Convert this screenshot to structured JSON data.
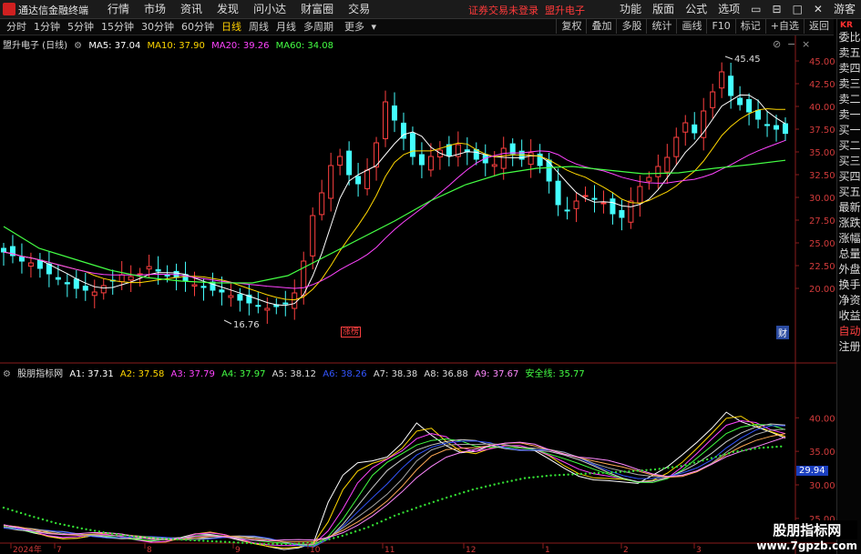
{
  "app": {
    "title": "通达信金融终端",
    "warning": "证券交易未登录",
    "stock_tab": "盟升电子",
    "guest": "游客"
  },
  "menu": [
    "行情",
    "市场",
    "资讯",
    "发现",
    "问小达",
    "财富圈",
    "交易"
  ],
  "right_menu": [
    "功能",
    "版面",
    "公式",
    "选项"
  ],
  "periods": [
    "分时",
    "1分钟",
    "5分钟",
    "15分钟",
    "30分钟",
    "60分钟",
    "日线",
    "周线",
    "月线",
    "多周期",
    "更多"
  ],
  "active_period": "日线",
  "right_tools": [
    "复权",
    "叠加",
    "多股",
    "统计",
    "画线",
    "F10",
    "标记",
    "+自选",
    "返回"
  ],
  "side_panel": {
    "kr": "KR",
    "items": [
      "委比",
      "卖五",
      "卖四",
      "卖三",
      "卖二",
      "卖一",
      "买一",
      "买二",
      "买三",
      "买四",
      "买五",
      "最新",
      "涨跌",
      "涨幅",
      "总量",
      "外盘",
      "换手",
      "净资",
      "收益"
    ],
    "items2": [
      "自动",
      "注册"
    ]
  },
  "main_legend": {
    "stock": "盟升电子 (日线)",
    "ma5": "MA5: 37.04",
    "ma10": "MA10: 37.90",
    "ma20": "MA20: 39.26",
    "ma60": "MA60: 34.08"
  },
  "sub_legend": {
    "name": "股朋指标网",
    "a1": "A1: 37.31",
    "a2": "A2: 37.58",
    "a3": "A3: 37.79",
    "a4": "A4: 37.97",
    "a5": "A5: 38.12",
    "a6": "A6: 38.26",
    "a7": "A7: 38.38",
    "a8": "A8: 36.88",
    "a9": "A9: 37.67",
    "safe": "安全线: 35.77"
  },
  "colors": {
    "ma5": "#ffffff",
    "ma10": "#ffd700",
    "ma20": "#ff44ff",
    "ma60": "#44ff44",
    "up": "#ff4040",
    "down": "#44ffff"
  },
  "annotations": {
    "high": "45.45",
    "low": "16.76",
    "tag": "涨榜",
    "cai": "财",
    "cursor_value": "29.94"
  },
  "chart_data": [
    {
      "type": "candlestick",
      "ylim": [
        17.5,
        46.5
      ],
      "y_ticks": [
        45.0,
        42.5,
        40.0,
        37.5,
        35.0,
        32.5,
        30.0,
        27.5,
        25.0,
        22.5,
        20.0
      ],
      "close_series": [
        24,
        23.6,
        23,
        22.8,
        22.2,
        21.6,
        21,
        20.5,
        20,
        19.8,
        19.6,
        20.3,
        20.8,
        21.5,
        21.3,
        21.6,
        22.4,
        21.9,
        21.4,
        21.2,
        20.8,
        20.4,
        20.1,
        19.8,
        19.6,
        19.2,
        18.7,
        18.4,
        18.1,
        17.8,
        18.0,
        18.3,
        19.5,
        23,
        28,
        30.5,
        33.5,
        34.5,
        32.5,
        31.5,
        33,
        36,
        40.5,
        38.5,
        36.5,
        34.5,
        33.6,
        34.5,
        35.2,
        34.6,
        35.8,
        35,
        34.2,
        33.8,
        33.6,
        35.4,
        34.8,
        34.2,
        34.9,
        33.5,
        31.8,
        29.2,
        28.6,
        29.6,
        30.2,
        29.8,
        29.4,
        28.2,
        27.8,
        29.6,
        31.2,
        32.2,
        33.4,
        34.4,
        36.6,
        38.2,
        37.1,
        39.5,
        41.6,
        43.8,
        41.2,
        40.2,
        39.4,
        38.6,
        37.9,
        37.5,
        37.04
      ],
      "ma60_series": [
        26.8,
        24.4,
        23.2,
        22.0,
        21.2,
        20.8,
        20.6,
        20.6,
        21.4,
        23.4,
        25.4,
        27.4,
        29.6,
        31.4,
        32.6,
        33.2,
        33.4,
        33.0,
        32.6,
        32.7,
        33.2,
        33.6,
        34.08
      ]
    },
    {
      "type": "line",
      "name": "股朋指标网",
      "ylim": [
        22,
        46
      ],
      "y_ticks": [
        40.0,
        35.0,
        30.0,
        25.0
      ],
      "a_series": [
        23.8,
        23.2,
        22.6,
        22.3,
        22.1,
        22.3,
        22.6,
        22.2,
        21.9,
        21.7,
        21.5,
        22.0,
        22.4,
        22.9,
        22.6,
        22.1,
        21.5,
        21.2,
        20.9,
        20.6,
        20.8,
        21.3,
        27.2,
        31.2,
        33.2,
        33.7,
        34.4,
        36.4,
        39.2,
        37.2,
        35.6,
        34.7,
        35.1,
        36.1,
        35.6,
        35.2,
        34.9,
        33.6,
        32.4,
        31.4,
        31.0,
        30.8,
        30.4,
        30.0,
        31.2,
        32.6,
        34.6,
        36.6,
        38.6,
        40.8,
        39.2,
        38.4,
        37.8,
        37.1
      ],
      "safe_series": [
        26.6,
        25.4,
        24.3,
        23.5,
        22.8,
        22.3,
        22.0,
        21.8,
        21.6,
        21.4,
        21.2,
        21.2,
        21.4,
        22.4,
        23.7,
        25.4,
        26.8,
        28.1,
        29.3,
        30.2,
        31.0,
        31.4,
        31.6,
        31.8,
        32.0,
        32.3,
        32.8,
        33.8,
        34.9,
        35.5,
        35.77
      ]
    }
  ],
  "x_axis": [
    "2024年",
    "7",
    "8",
    "9",
    "10",
    "11",
    "12",
    "1",
    "2",
    "3"
  ],
  "watermark": {
    "line1": "股朋指标网",
    "line2": "www.7gpzb.com"
  }
}
